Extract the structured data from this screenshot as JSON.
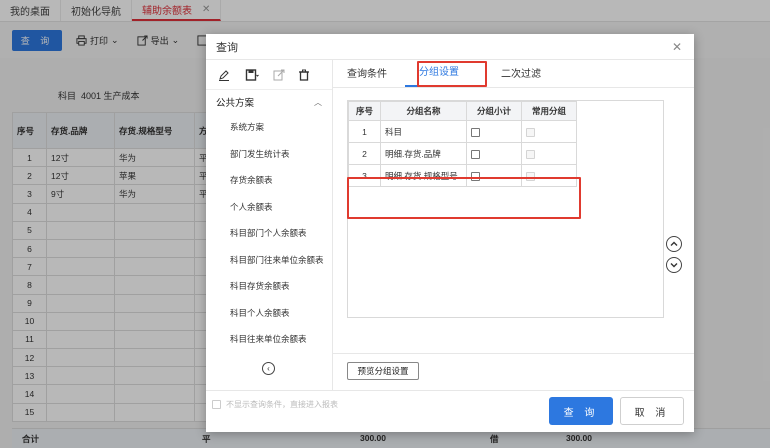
{
  "tabs": [
    {
      "label": "我的桌面"
    },
    {
      "label": "初始化导航"
    },
    {
      "label": "辅助余额表"
    }
  ],
  "toolbar": {
    "query_label": "查 询",
    "print_label": "打印",
    "export_label": "导出"
  },
  "report": {
    "subject_label": "科目",
    "subject_value": "4001 生产成本",
    "headers": [
      "序号",
      "存货.品牌",
      "存货.规格型号",
      "方"
    ],
    "rows": [
      [
        "1",
        "12寸",
        "华为",
        "平"
      ],
      [
        "2",
        "12寸",
        "苹果",
        "平"
      ],
      [
        "3",
        "9寸",
        "华为",
        "平"
      ],
      [
        "4",
        "",
        "",
        ""
      ],
      [
        "5",
        "",
        "",
        ""
      ],
      [
        "6",
        "",
        "",
        ""
      ],
      [
        "7",
        "",
        "",
        ""
      ],
      [
        "8",
        "",
        "",
        ""
      ],
      [
        "9",
        "",
        "",
        ""
      ],
      [
        "10",
        "",
        "",
        ""
      ],
      [
        "11",
        "",
        "",
        ""
      ],
      [
        "12",
        "",
        "",
        ""
      ],
      [
        "13",
        "",
        "",
        ""
      ],
      [
        "14",
        "",
        "",
        ""
      ],
      [
        "15",
        "",
        "",
        ""
      ]
    ],
    "footer": {
      "label": "合计",
      "dir": "平",
      "value1": "300.00",
      "dir2": "借",
      "value2": "300.00"
    }
  },
  "dialog": {
    "title": "查询",
    "plan_group_title": "公共方案",
    "plans": [
      "系统方案",
      "部门发生统计表",
      "存货余额表",
      "个人余额表",
      "科目部门个人余额表",
      "科目部门往来单位余额表",
      "科目存货余额表",
      "科目个人余额表",
      "科目往来单位余额表"
    ],
    "tabs": [
      "查询条件",
      "分组设置",
      "二次过滤"
    ],
    "group_table": {
      "headers": [
        "序号",
        "分组名称",
        "分组小计",
        "常用分组"
      ],
      "rows": [
        {
          "index": "1",
          "name": "科目"
        },
        {
          "index": "2",
          "name": "明细.存货.品牌"
        },
        {
          "index": "3",
          "name": "明细.存货.规格型号"
        }
      ]
    },
    "preview_button": "预览分组设置",
    "skip_label": "不显示查询条件，直接进入报表",
    "query_button": "查 询",
    "cancel_button": "取 消"
  },
  "colors": {
    "accent": "#2d78e0",
    "highlight": "#e03a2f",
    "active_tab": "#e0303a"
  }
}
